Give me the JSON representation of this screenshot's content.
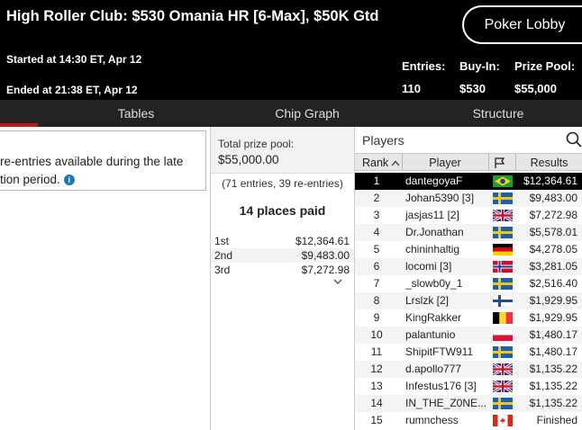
{
  "header": {
    "title": "High Roller Club: $530 Omania HR [6-Max], $50K Gtd",
    "lobby_button": "Poker Lobby",
    "started": "Started at 14:30 ET, Apr 12",
    "ended": "Ended at 21:38 ET, Apr 12",
    "stats": [
      {
        "label": "Entries:",
        "value": "110"
      },
      {
        "label": "Buy-In:",
        "value": "$530"
      },
      {
        "label": "Prize Pool:",
        "value": "$55,000"
      }
    ]
  },
  "tabs": [
    "Tables",
    "Chip Graph",
    "Structure"
  ],
  "left_panel": {
    "line1": "re-entries available during the late",
    "line2": "tion period."
  },
  "prize": {
    "label": "Total prize pool:",
    "amount": "$55,000.00",
    "entries_note": "(71 entries, 39 re-entries)",
    "places_paid": "14 places paid",
    "payouts": [
      {
        "place": "1st",
        "amount": "$12,364.61"
      },
      {
        "place": "2nd",
        "amount": "$9,483.00"
      },
      {
        "place": "3rd",
        "amount": "$7,272.98"
      }
    ]
  },
  "players": {
    "title": "Players",
    "headers": {
      "rank": "Rank",
      "player": "Player",
      "results": "Results"
    },
    "rows": [
      {
        "rank": "1",
        "name": "dantegoyaF",
        "flag": "brazil-flag",
        "result": "$12,364.61"
      },
      {
        "rank": "2",
        "name": "Johan5390 [3]",
        "flag": "sweden-flag",
        "result": "$9,483.00"
      },
      {
        "rank": "3",
        "name": "jasjas11 [2]",
        "flag": "uk-flag",
        "result": "$7,272.98"
      },
      {
        "rank": "4",
        "name": "Dr.Jonathan",
        "flag": "sweden-flag",
        "result": "$5,578.01"
      },
      {
        "rank": "5",
        "name": "chininhaltig",
        "flag": "germany-flag",
        "result": "$4,278.05"
      },
      {
        "rank": "6",
        "name": "locomi [3]",
        "flag": "norway-flag",
        "result": "$3,281.05"
      },
      {
        "rank": "7",
        "name": "_slowb0y_1",
        "flag": "sweden-flag",
        "result": "$2,516.40"
      },
      {
        "rank": "8",
        "name": "Lrslzk [2]",
        "flag": "finland-flag",
        "result": "$1,929.95"
      },
      {
        "rank": "9",
        "name": "KingRakker",
        "flag": "belgium-flag",
        "result": "$1,929.95"
      },
      {
        "rank": "10",
        "name": "palantunio",
        "flag": "poland-flag",
        "result": "$1,480.17"
      },
      {
        "rank": "11",
        "name": "ShipitFTW911",
        "flag": "sweden-flag",
        "result": "$1,480.17"
      },
      {
        "rank": "12",
        "name": "d.apollo777",
        "flag": "uk-flag",
        "result": "$1,135.22"
      },
      {
        "rank": "13",
        "name": "Infestus176 [3]",
        "flag": "uk-flag",
        "result": "$1,135.22"
      },
      {
        "rank": "14",
        "name": "IN_THE_Z0NE...",
        "flag": "sweden-flag",
        "result": "$1,135.22"
      },
      {
        "rank": "15",
        "name": "rumnchess",
        "flag": "canada-flag",
        "result": "Finished"
      }
    ]
  },
  "colors": {
    "header_bg": "#000000",
    "tab_bg": "#232323",
    "accent_red": "#c4161c",
    "highlight_row": "#000000",
    "info_blue": "#1a7ab8"
  }
}
